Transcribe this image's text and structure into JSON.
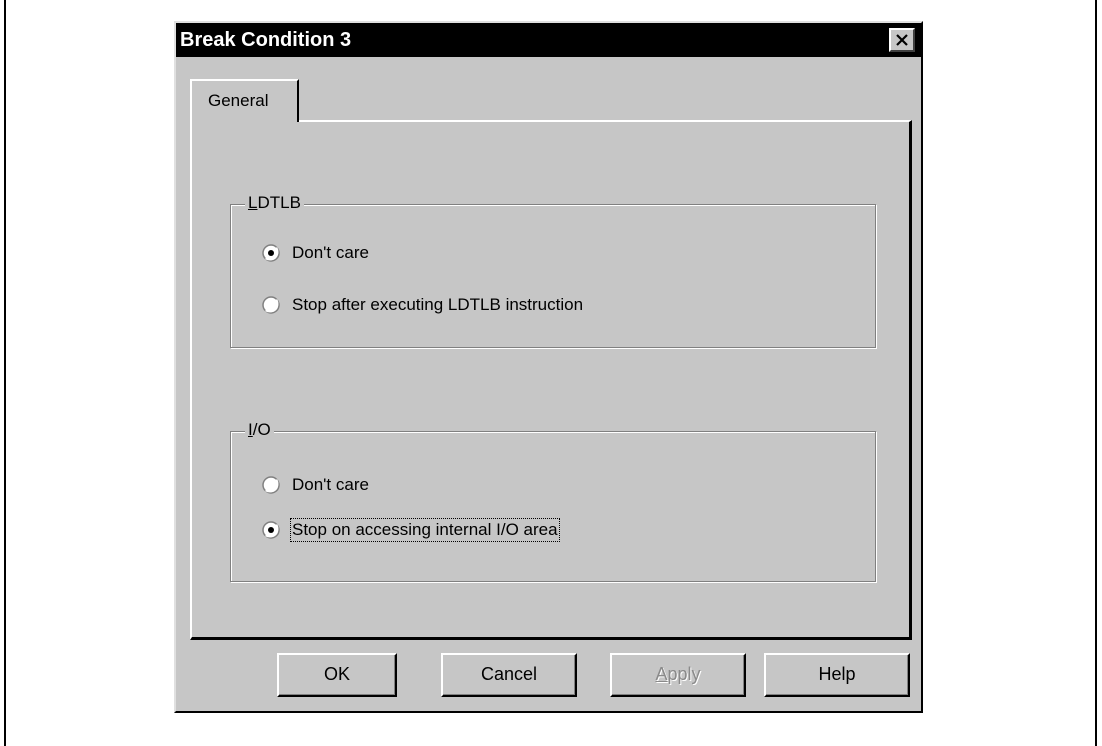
{
  "dialog": {
    "title": "Break Condition 3",
    "close_icon": "close-x-icon"
  },
  "tabs": [
    {
      "label": "General",
      "selected": true
    }
  ],
  "groups": {
    "ldtlb": {
      "title_mnemonic": "L",
      "title_rest": "DTLB",
      "options": [
        {
          "label": "Don't care",
          "selected": true
        },
        {
          "label": "Stop after executing LDTLB instruction",
          "selected": false
        }
      ]
    },
    "io": {
      "title_mnemonic": "I",
      "title_rest": "/O",
      "options": [
        {
          "label": "Don't care",
          "selected": false
        },
        {
          "label": "Stop on accessing internal I/O area",
          "selected": true
        }
      ]
    }
  },
  "buttons": {
    "ok": "OK",
    "cancel": "Cancel",
    "apply_mnemonic": "A",
    "apply_rest": "pply",
    "apply_enabled": false,
    "help": "Help"
  }
}
